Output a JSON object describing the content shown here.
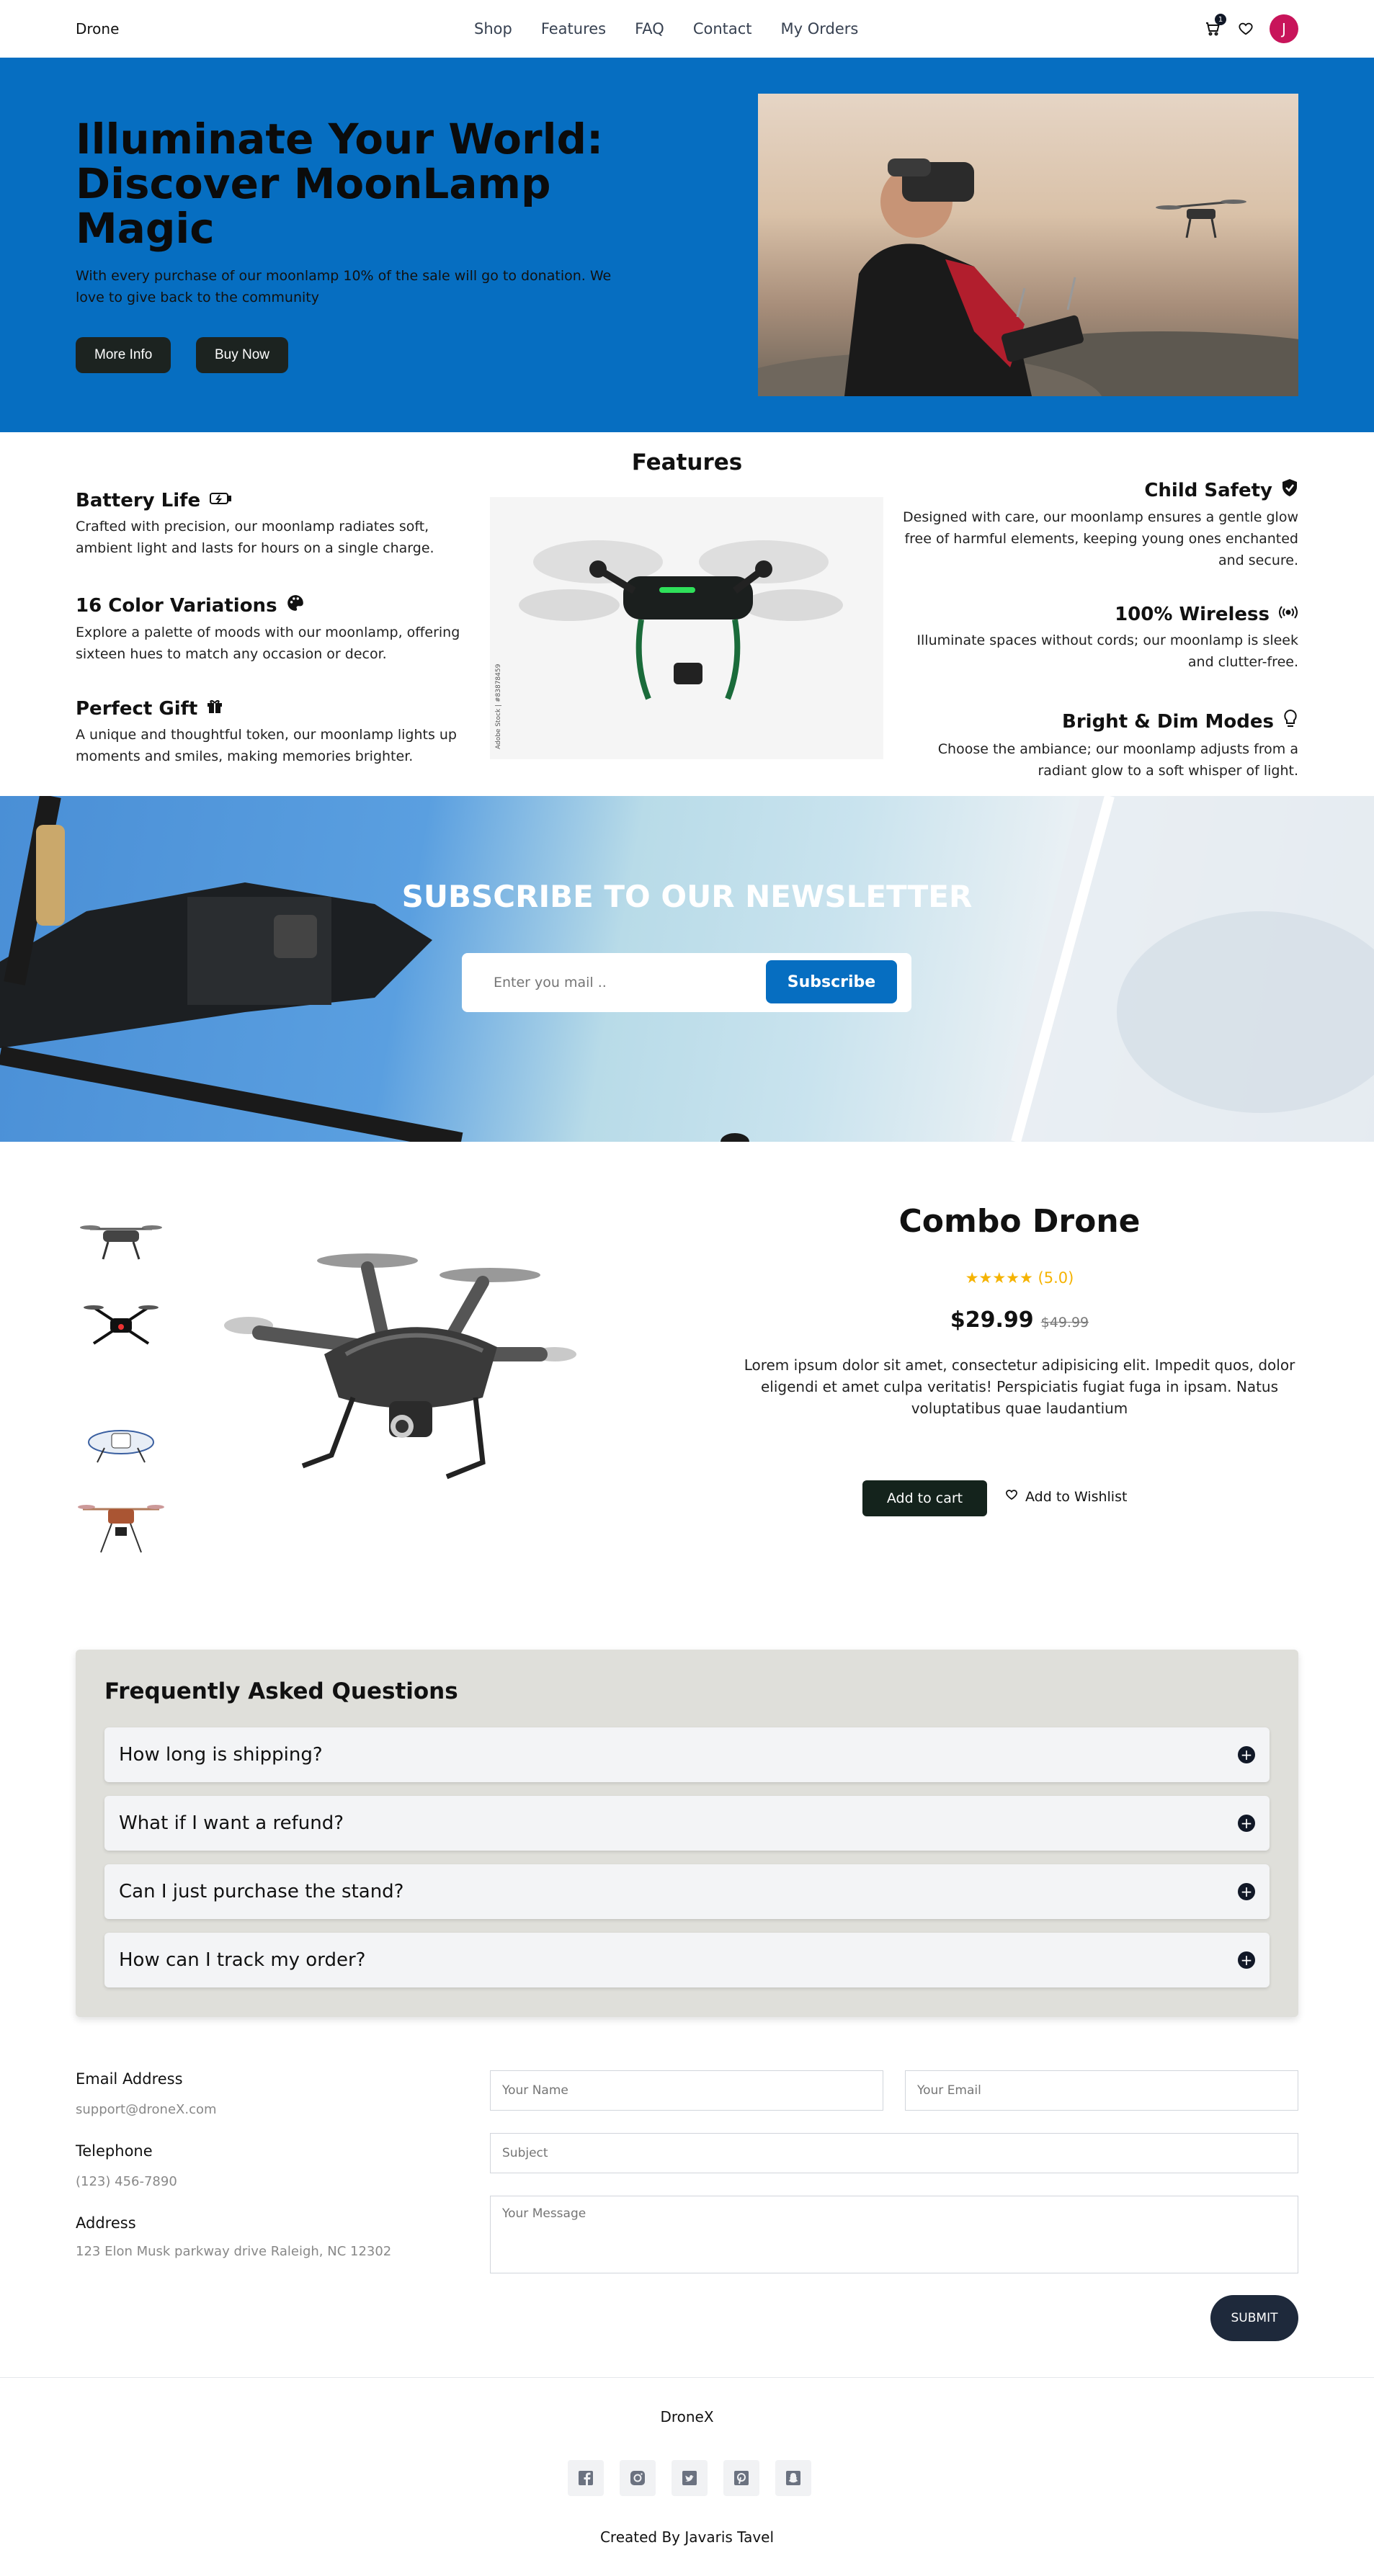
{
  "nav": {
    "brand": "Drone",
    "links": [
      "Shop",
      "Features",
      "FAQ",
      "Contact",
      "My Orders"
    ],
    "cart_count": "1",
    "avatar_letter": "J"
  },
  "hero": {
    "title": "Illuminate Your World: Discover MoonLamp Magic",
    "text": "With every purchase of our moonlamp 10% of the sale will go to donation. We love to give back to the community",
    "more_info": "More Info",
    "buy_now": "Buy Now"
  },
  "features": {
    "title": "Features",
    "left": [
      {
        "title": "Battery Life",
        "text": "Crafted with precision, our moonlamp radiates soft, ambient light and lasts for hours on a single charge.",
        "icon": "battery-charging-icon"
      },
      {
        "title": "16 Color Variations",
        "text": "Explore a palette of moods with our moonlamp, offering sixteen hues to match any occasion or decor.",
        "icon": "palette-icon"
      },
      {
        "title": "Perfect Gift",
        "text": "A unique and thoughtful token, our moonlamp lights up moments and smiles, making memories brighter.",
        "icon": "gift-icon"
      }
    ],
    "right": [
      {
        "title": "Child Safety",
        "text": "Designed with care, our moonlamp ensures a gentle glow free of harmful elements, keeping young ones enchanted and secure.",
        "icon": "shield-check-icon"
      },
      {
        "title": "100% Wireless",
        "text": "Illuminate spaces without cords; our moonlamp is sleek and clutter-free.",
        "icon": "wireless-icon"
      },
      {
        "title": "Bright & Dim Modes",
        "text": "Choose the ambiance; our moonlamp adjusts from a radiant glow to a soft whisper of light.",
        "icon": "lightbulb-icon"
      }
    ],
    "image_caption": "Adobe Stock | #83878459"
  },
  "newsletter": {
    "title": "SUBSCRIBE TO OUR NEWSLETTER",
    "placeholder": "Enter you mail ..",
    "button": "Subscribe"
  },
  "product": {
    "name": "Combo Drone",
    "stars": "★★★★★",
    "rating": "(5.0)",
    "price": "$29.99",
    "old_price": "$49.99",
    "description": "Lorem ipsum dolor sit amet, consectetur adipisicing elit. Impedit quos, dolor eligendi et amet culpa veritatis! Perspiciatis fugiat fuga in ipsam. Natus voluptatibus quae laudantium",
    "add_to_cart": "Add to cart",
    "add_to_wishlist": "Add to Wishlist"
  },
  "faq": {
    "title": "Frequently Asked Questions",
    "items": [
      "How long is shipping?",
      "What if I want a refund?",
      "Can I just purchase the stand?",
      "How can I track my order?"
    ]
  },
  "contact": {
    "email_label": "Email Address",
    "email_value": "support@droneX.com",
    "phone_label": "Telephone",
    "phone_value": "(123) 456-7890",
    "address_label": "Address",
    "address_value": "123 Elon Musk parkway drive Raleigh, NC 12302",
    "name_placeholder": "Your Name",
    "email_placeholder": "Your Email",
    "subject_placeholder": "Subject",
    "message_placeholder": "Your Message",
    "submit": "SUBMIT"
  },
  "footer": {
    "brand": "DroneX",
    "credit": "Created By Javaris Tavel",
    "socials": [
      "facebook-icon",
      "instagram-icon",
      "twitter-icon",
      "pinterest-icon",
      "snapchat-icon"
    ]
  },
  "colors": {
    "brand_blue": "#066ec1",
    "avatar": "#c8145a",
    "dark_button": "#1c2320",
    "star": "#f5b301"
  }
}
